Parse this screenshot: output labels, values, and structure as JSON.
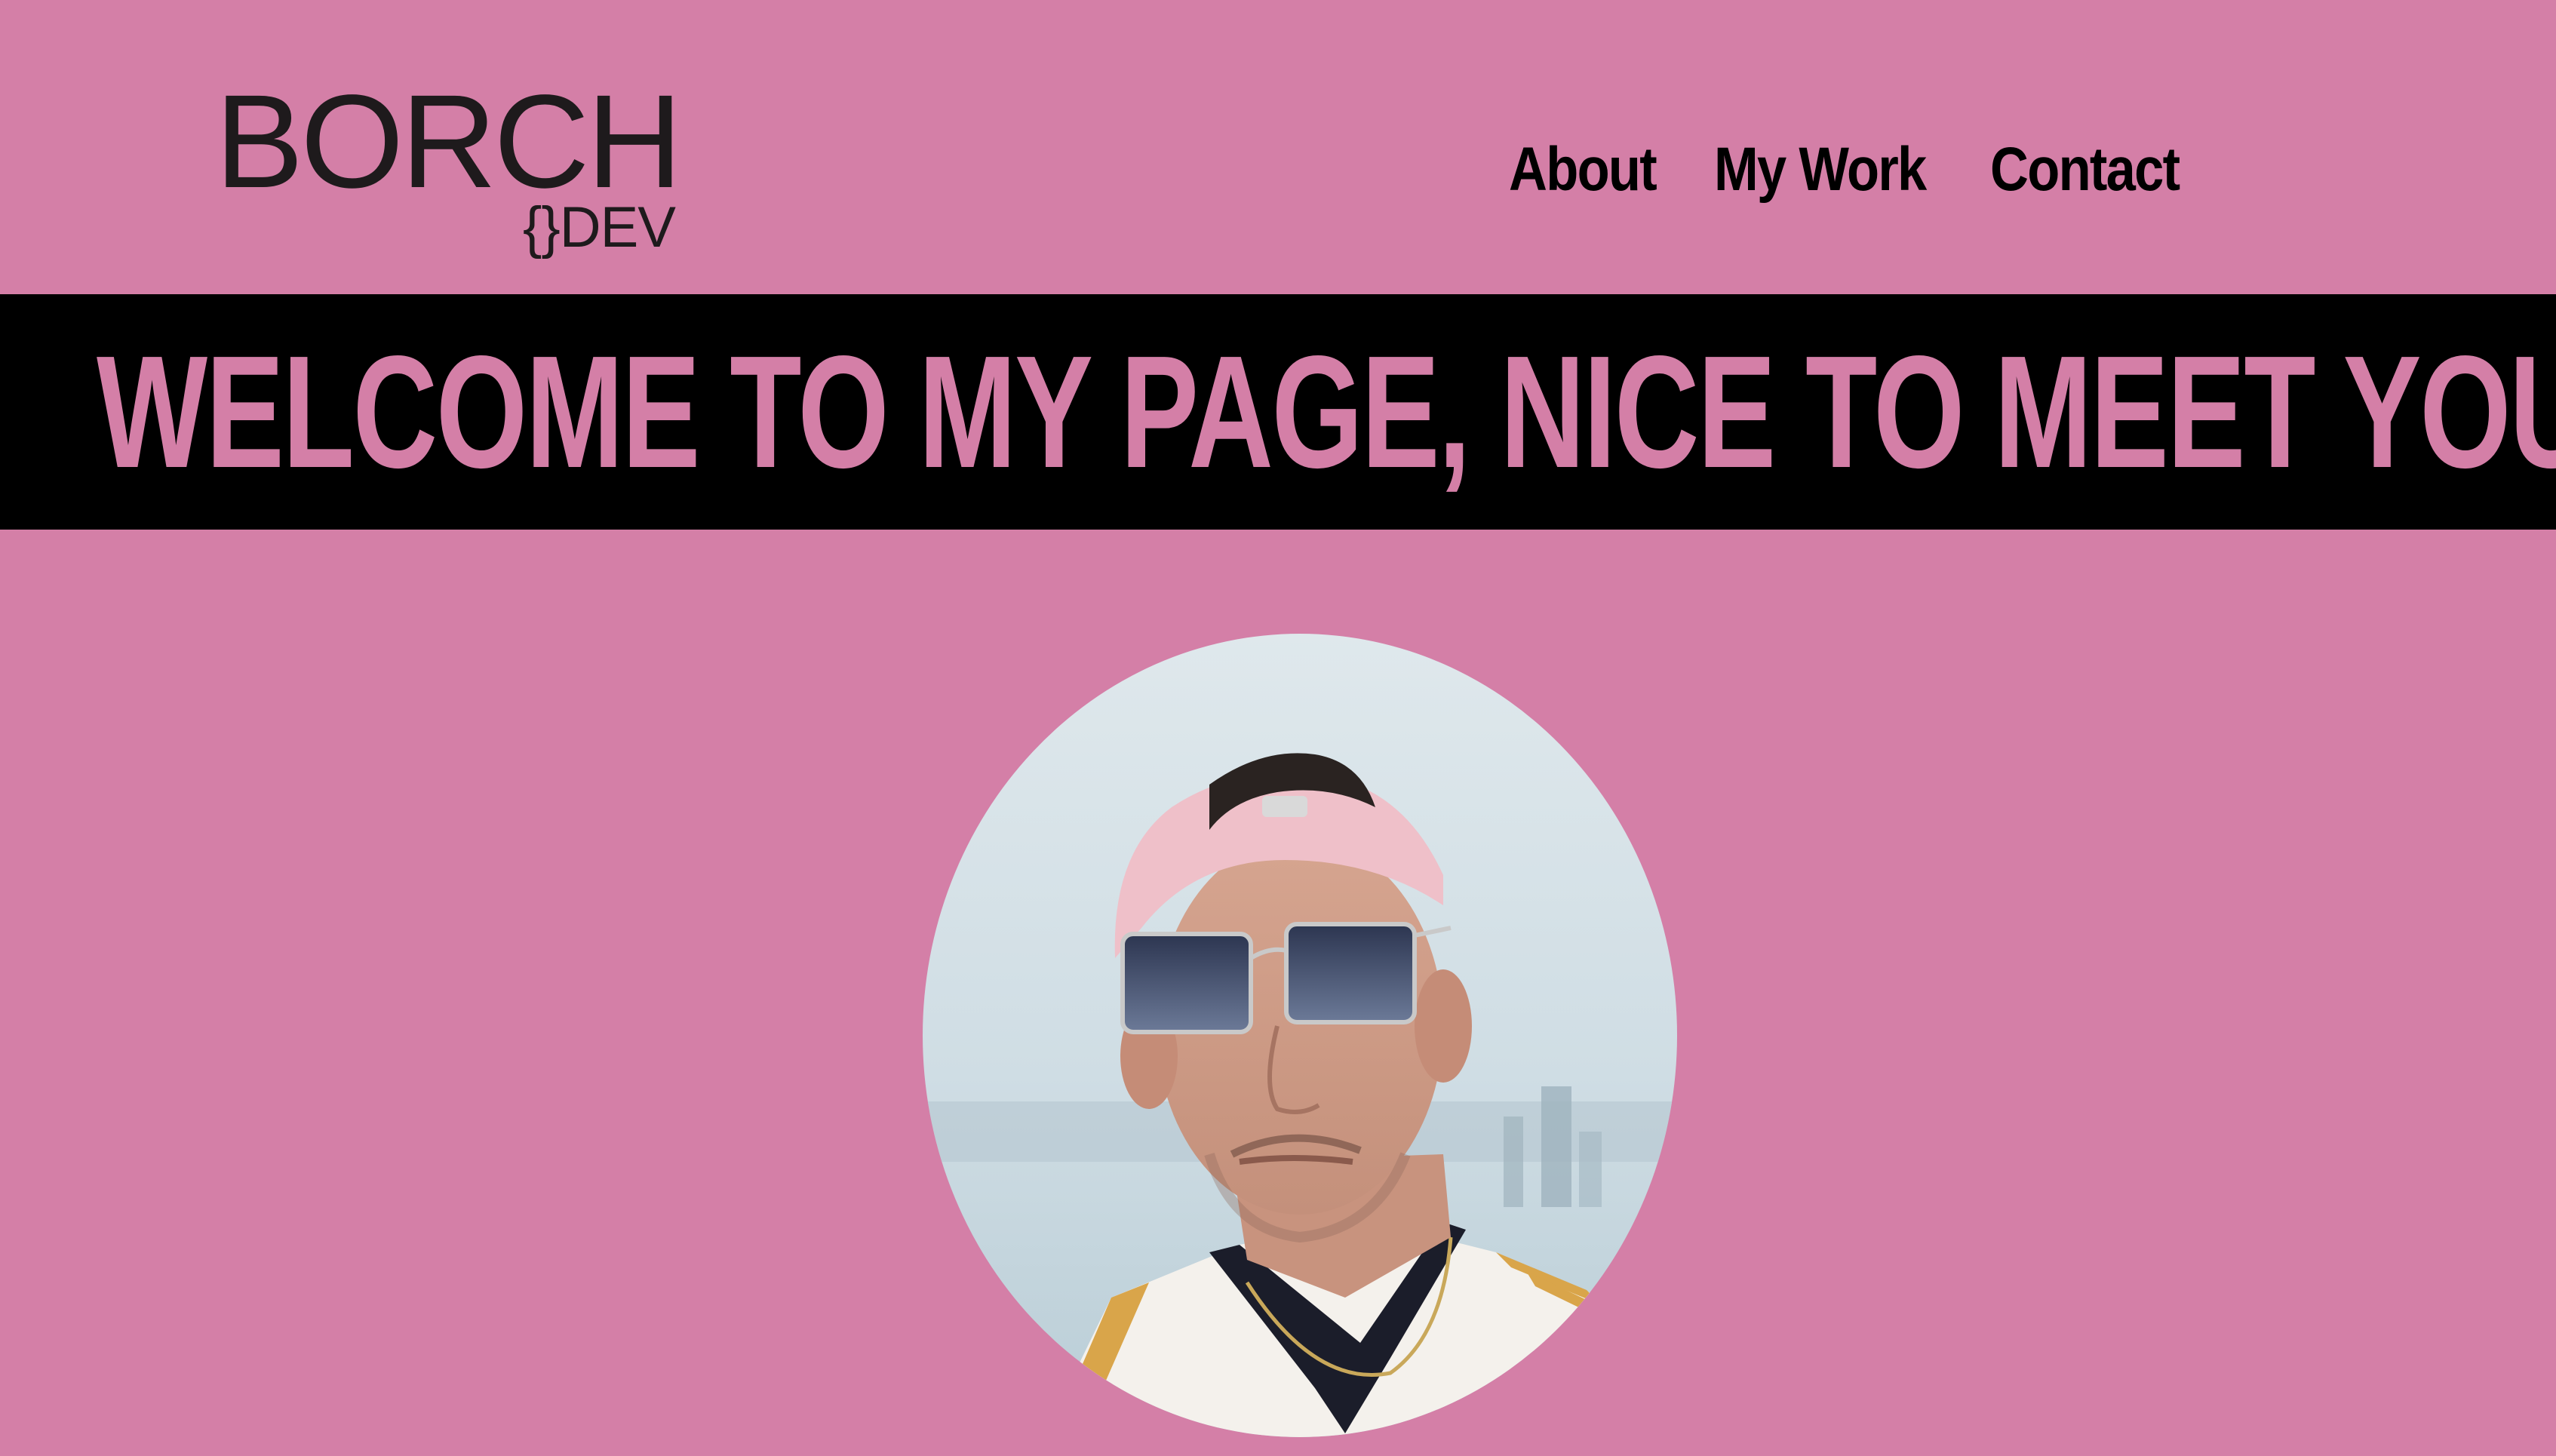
{
  "header": {
    "logo": {
      "main": "BORCH",
      "sub": "{}DEV"
    },
    "nav": [
      {
        "label": "About"
      },
      {
        "label": "My Work"
      },
      {
        "label": "Contact"
      }
    ]
  },
  "hero": {
    "banner_text": "WELCOME TO MY PAGE, NICE TO MEET YOU!"
  },
  "colors": {
    "background": "#d47fa7",
    "banner": "#000000",
    "banner_text": "#d47fa7",
    "text_dark": "#1e1a1c"
  }
}
